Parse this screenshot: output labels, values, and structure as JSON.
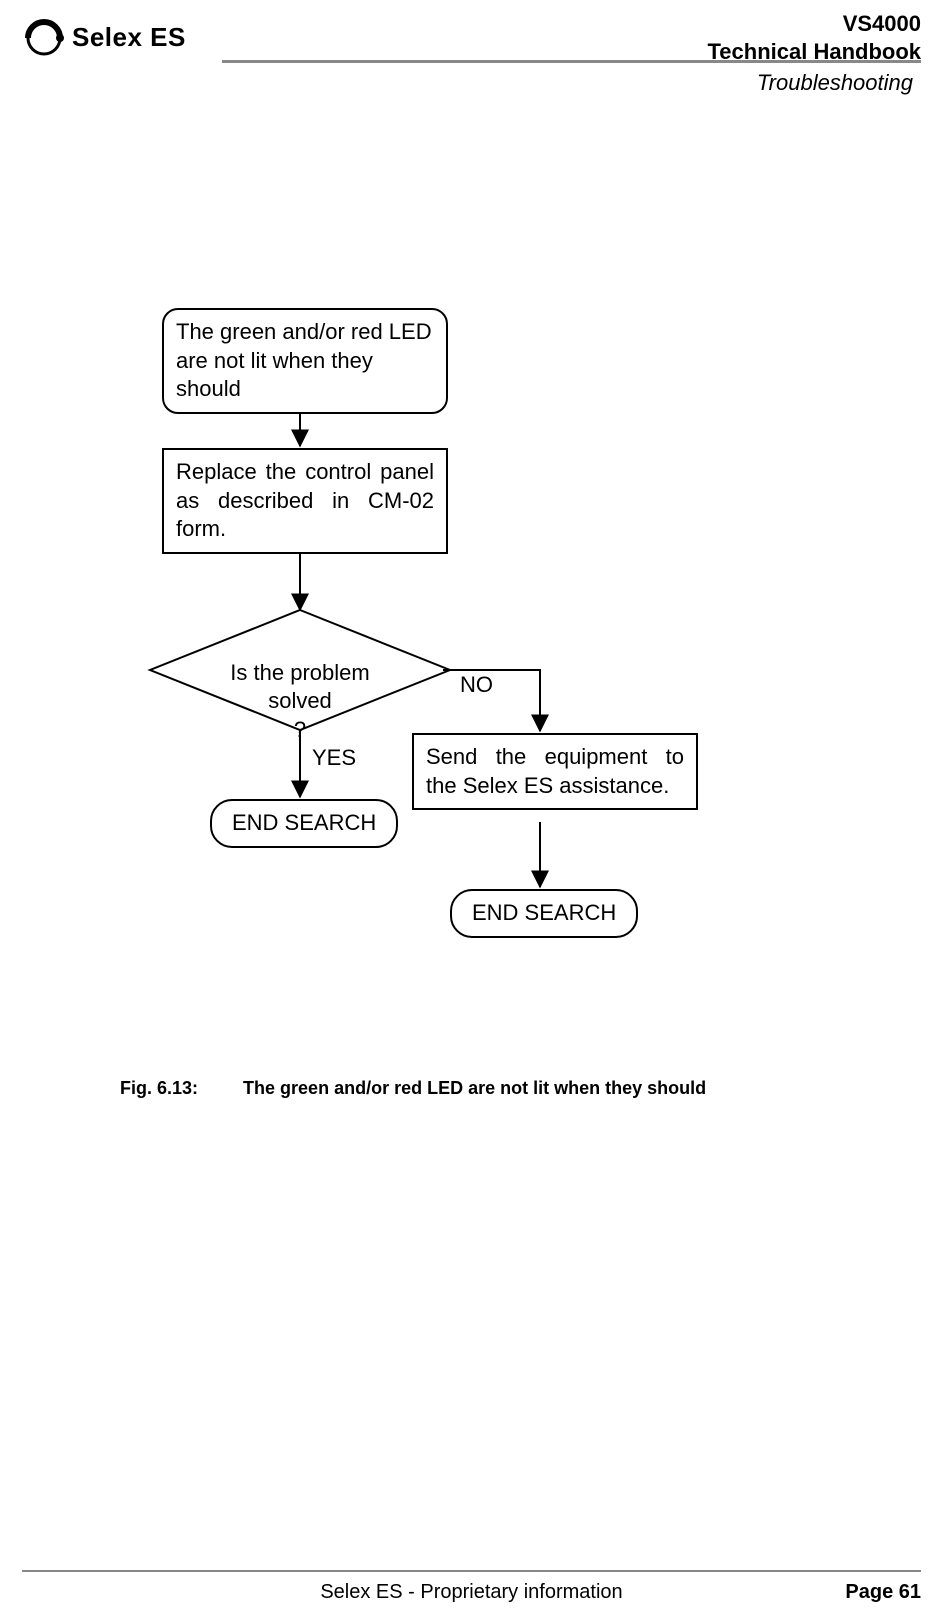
{
  "header": {
    "company": "Selex ES",
    "doc_code": "VS4000",
    "doc_title": "Technical Handbook",
    "section": "Troubleshooting"
  },
  "flow": {
    "start": "The green and/or red LED are not lit when they should",
    "step1": "Replace the control panel as described in CM-02 form.",
    "decision": "Is the problem solved\n?",
    "yes": "YES",
    "no": "NO",
    "no_step": "Send the equipment to the Selex ES assistance.",
    "end_yes": "END SEARCH",
    "end_no": "END SEARCH"
  },
  "caption": {
    "figure": "Fig. 6.13:",
    "text": "The green and/or red LED are not lit when they should"
  },
  "footer": {
    "center": "Selex ES - Proprietary information",
    "right": "Page 61"
  }
}
